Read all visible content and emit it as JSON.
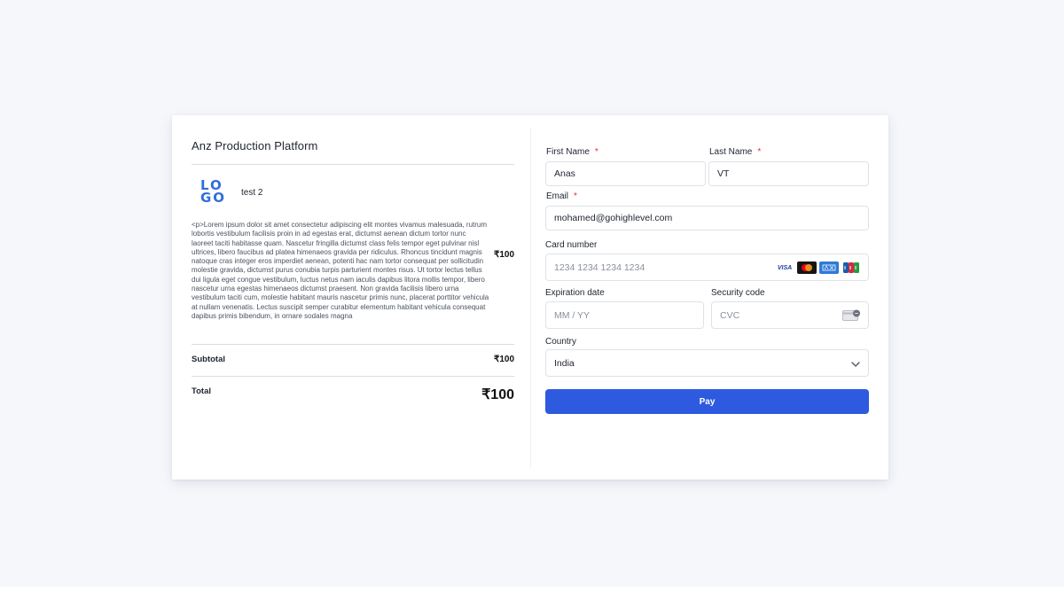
{
  "order": {
    "platform_name": "Anz Production Platform",
    "logo_text": [
      "LO",
      "GO"
    ],
    "product": {
      "name": "test 2",
      "description": "<p>Lorem ipsum dolor sit amet consectetur adipiscing elit montes vivamus malesuada, rutrum lobortis vestibulum facilisis proin in ad egestas erat, dictumst aenean dictum tortor nunc laoreet taciti habitasse quam. Nascetur fringilla dictumst class felis tempor eget pulvinar nisl ultrices, libero faucibus ad platea himenaeos gravida per ridiculus. Rhoncus tincidunt magnis natoque cras integer eros imperdiet aenean, potenti hac nam tortor consequat per sollicitudin molestie gravida, dictumst purus conubia turpis parturient montes risus. Ut tortor lectus tellus dui ligula eget congue vestibulum, luctus netus nam iaculis dapibus litora mollis tempor, libero nascetur urna egestas himenaeos dictumst praesent. Non gravida facilisis libero urna vestibulum taciti cum, molestie habitant mauris nascetur primis nunc, placerat porttitor vehicula at nullam venenatis. Lectus suscipit semper curabitur elementum habitant vehicula consequat dapibus primis bibendum, in ornare sodales magna",
      "price": "₹100"
    },
    "subtotal_label": "Subtotal",
    "subtotal_value": "₹100",
    "total_label": "Total",
    "total_value": "₹100"
  },
  "form": {
    "first_name": {
      "label": "First Name",
      "required": "*",
      "value": "Anas"
    },
    "last_name": {
      "label": "Last Name",
      "required": "*",
      "value": "VT"
    },
    "email": {
      "label": "Email",
      "required": "*",
      "value": "mohamed@gohighlevel.com"
    },
    "card_number": {
      "label": "Card number",
      "placeholder": "1234 1234 1234 1234",
      "brands": [
        "visa",
        "mastercard",
        "amex",
        "jcb"
      ],
      "visa_text": "VISA"
    },
    "expiration": {
      "label": "Expiration date",
      "placeholder": "MM / YY"
    },
    "security_code": {
      "label": "Security code",
      "placeholder": "CVC"
    },
    "country": {
      "label": "Country",
      "value": "India"
    },
    "pay_label": "Pay"
  },
  "colors": {
    "accent": "#2e5ae0",
    "logo": "#2f6fda",
    "required": "#e0302f"
  }
}
